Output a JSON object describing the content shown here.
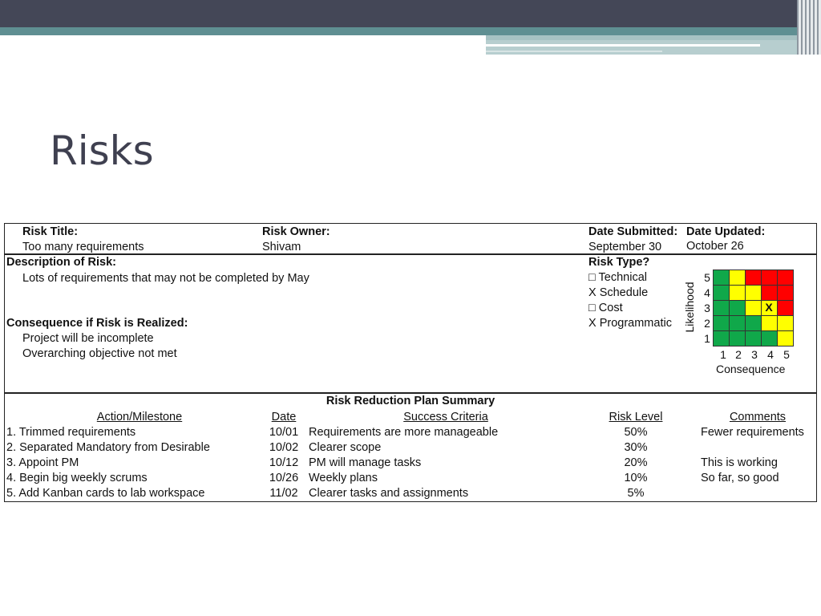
{
  "slide": {
    "title": "Risks"
  },
  "header": {
    "risk_title_label": "Risk Title:",
    "risk_title_value": "Too many requirements",
    "risk_owner_label": "Risk Owner:",
    "risk_owner_value": "Shivam",
    "date_submitted_label": "Date Submitted:",
    "date_submitted_value": "September 30",
    "date_updated_label": "Date Updated:",
    "date_updated_value": "October 26"
  },
  "description": {
    "label": "Description of Risk:",
    "text": "Lots of requirements that may not be completed by May"
  },
  "consequence": {
    "label": "Consequence if Risk is Realized:",
    "lines": [
      "Project will be incomplete",
      "Overarching objective not met"
    ]
  },
  "risk_type": {
    "label": "Risk Type?",
    "items": [
      "□ Technical",
      "X Schedule",
      "□ Cost",
      "X Programmatic"
    ]
  },
  "risk_matrix": {
    "y_label": "Likelihood",
    "x_label": "Consequence",
    "likelihood_ticks": [
      "5",
      "4",
      "3",
      "2",
      "1"
    ],
    "consequence_ticks": [
      "1",
      "2",
      "3",
      "4",
      "5"
    ],
    "colors": {
      "green": "#10a84a",
      "yellow": "#ffff00",
      "red": "#ff0000"
    },
    "grid": [
      [
        "green",
        "yellow",
        "red",
        "red",
        "red"
      ],
      [
        "green",
        "yellow",
        "yellow",
        "red",
        "red"
      ],
      [
        "green",
        "green",
        "yellow",
        "yellow",
        "red"
      ],
      [
        "green",
        "green",
        "green",
        "yellow",
        "yellow"
      ],
      [
        "green",
        "green",
        "green",
        "green",
        "yellow"
      ]
    ],
    "marker": {
      "text": "X",
      "likelihood": 3,
      "consequence": 4
    }
  },
  "plan": {
    "title": "Risk Reduction Plan Summary",
    "headers": {
      "action": "Action/Milestone",
      "date": "Date",
      "criteria": "Success Criteria",
      "level": "Risk Level",
      "comments": "Comments"
    },
    "rows": [
      {
        "action": "1.  Trimmed requirements",
        "date": "10/01",
        "criteria": "Requirements are more manageable",
        "level": "50%",
        "comments": "Fewer requirements"
      },
      {
        "action": "2.  Separated Mandatory from Desirable",
        "date": "10/02",
        "criteria": "Clearer scope",
        "level": "30%",
        "comments": ""
      },
      {
        "action": "3.  Appoint PM",
        "date": "10/12",
        "criteria": "PM will manage tasks",
        "level": "20%",
        "comments": "This is working"
      },
      {
        "action": "4.  Begin big weekly scrums",
        "date": "10/26",
        "criteria": "Weekly plans",
        "level": "10%",
        "comments": "So far, so good"
      },
      {
        "action": "5.  Add Kanban cards to lab workspace",
        "date": "11/02",
        "criteria": "Clearer tasks and assignments",
        "level": "5%",
        "comments": ""
      }
    ]
  }
}
